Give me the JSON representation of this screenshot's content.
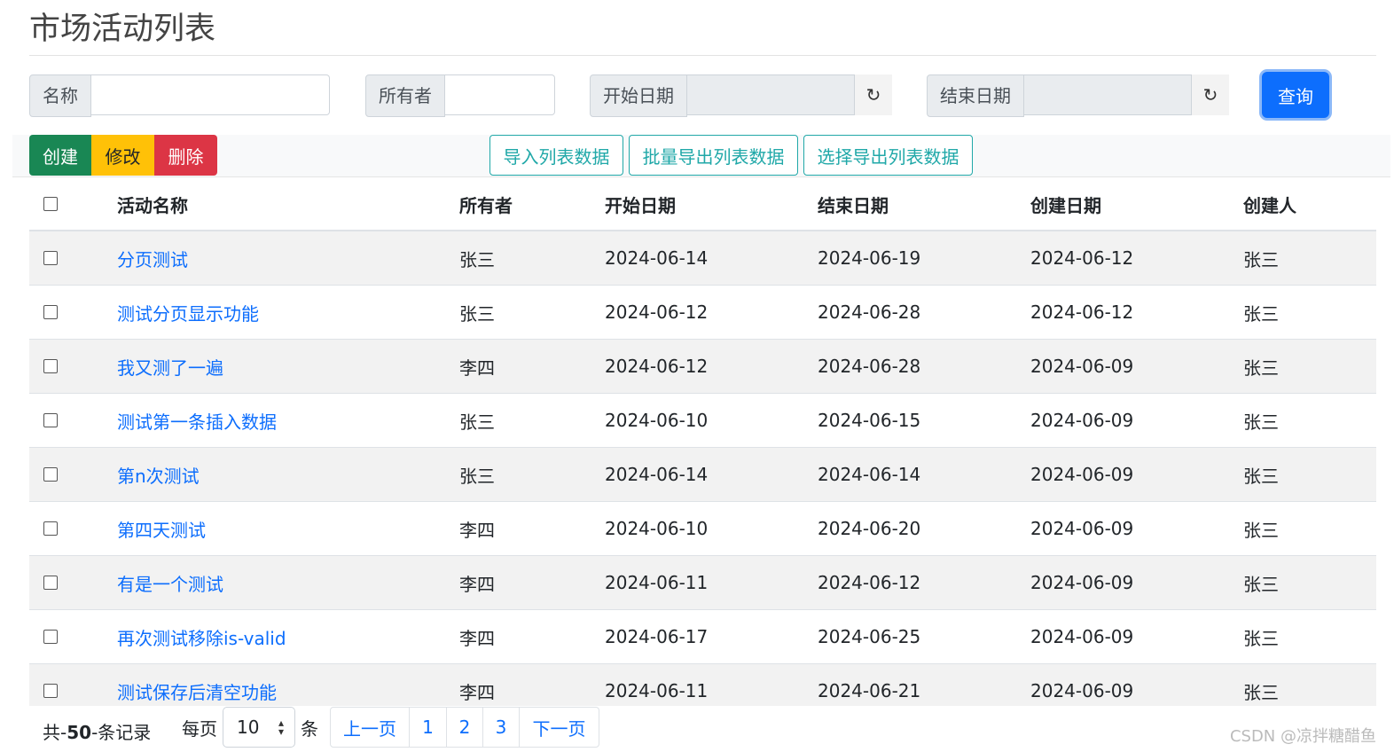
{
  "page": {
    "title": "市场活动列表"
  },
  "search": {
    "name_label": "名称",
    "name_value": "",
    "owner_label": "所有者",
    "owner_value": "",
    "start_label": "开始日期",
    "start_value": "",
    "end_label": "结束日期",
    "end_value": "",
    "refresh_icon": "↻",
    "query_label": "查询"
  },
  "toolbar": {
    "create_label": "创建",
    "edit_label": "修改",
    "delete_label": "删除",
    "import_label": "导入列表数据",
    "export_all_label": "批量导出列表数据",
    "export_selected_label": "选择导出列表数据"
  },
  "table": {
    "headers": [
      "活动名称",
      "所有者",
      "开始日期",
      "结束日期",
      "创建日期",
      "创建人"
    ],
    "rows": [
      {
        "name": "分页测试",
        "owner": "张三",
        "start": "2024-06-14",
        "end": "2024-06-19",
        "created": "2024-06-12",
        "creator": "张三"
      },
      {
        "name": "测试分页显示功能",
        "owner": "张三",
        "start": "2024-06-12",
        "end": "2024-06-28",
        "created": "2024-06-12",
        "creator": "张三"
      },
      {
        "name": "我又测了一遍",
        "owner": "李四",
        "start": "2024-06-12",
        "end": "2024-06-28",
        "created": "2024-06-09",
        "creator": "张三"
      },
      {
        "name": "测试第一条插入数据",
        "owner": "张三",
        "start": "2024-06-10",
        "end": "2024-06-15",
        "created": "2024-06-09",
        "creator": "张三"
      },
      {
        "name": "第n次测试",
        "owner": "张三",
        "start": "2024-06-14",
        "end": "2024-06-14",
        "created": "2024-06-09",
        "creator": "张三"
      },
      {
        "name": "第四天测试",
        "owner": "李四",
        "start": "2024-06-10",
        "end": "2024-06-20",
        "created": "2024-06-09",
        "creator": "张三"
      },
      {
        "name": "有是一个测试",
        "owner": "李四",
        "start": "2024-06-11",
        "end": "2024-06-12",
        "created": "2024-06-09",
        "creator": "张三"
      },
      {
        "name": "再次测试移除is-valid",
        "owner": "李四",
        "start": "2024-06-17",
        "end": "2024-06-25",
        "created": "2024-06-09",
        "creator": "张三"
      },
      {
        "name": "测试保存后清空功能",
        "owner": "李四",
        "start": "2024-06-11",
        "end": "2024-06-21",
        "created": "2024-06-09",
        "creator": "张三"
      }
    ]
  },
  "pagination": {
    "total_prefix": "共-",
    "total_count": "50",
    "total_suffix": "-条记录",
    "per_page_label": "每页",
    "per_page_value": "10",
    "unit_label": "条",
    "prev_label": "上一页",
    "pages": [
      "1",
      "2",
      "3"
    ],
    "next_label": "下一页"
  },
  "watermark": "CSDN @凉拌糖醋鱼"
}
